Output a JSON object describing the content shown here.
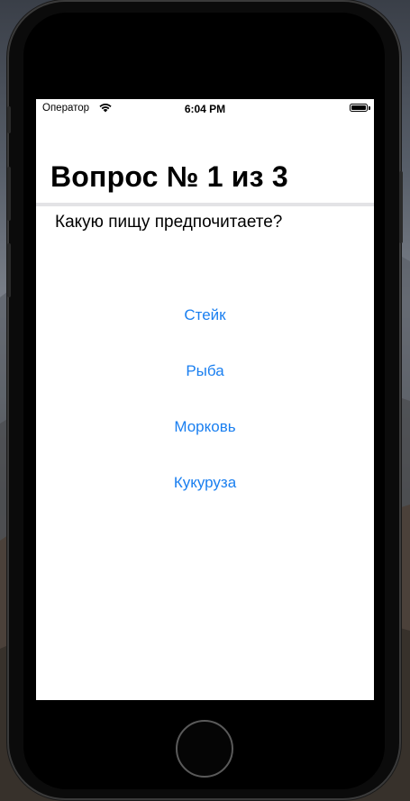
{
  "status_bar": {
    "carrier": "Оператор",
    "wifi_icon": "wifi-icon",
    "time": "6:04 PM",
    "battery_icon": "battery-icon",
    "battery_level": 1.0
  },
  "nav": {
    "title": "Вопрос № 1 из 3"
  },
  "question": {
    "text": "Какую пищу предпочитаете?"
  },
  "answers": [
    {
      "label": "Стейк"
    },
    {
      "label": "Рыба"
    },
    {
      "label": "Морковь"
    },
    {
      "label": "Кукуруза"
    }
  ],
  "colors": {
    "accent": "#1a7ff0",
    "screen_background": "#ffffff",
    "device_body": "#0b0b0b"
  }
}
